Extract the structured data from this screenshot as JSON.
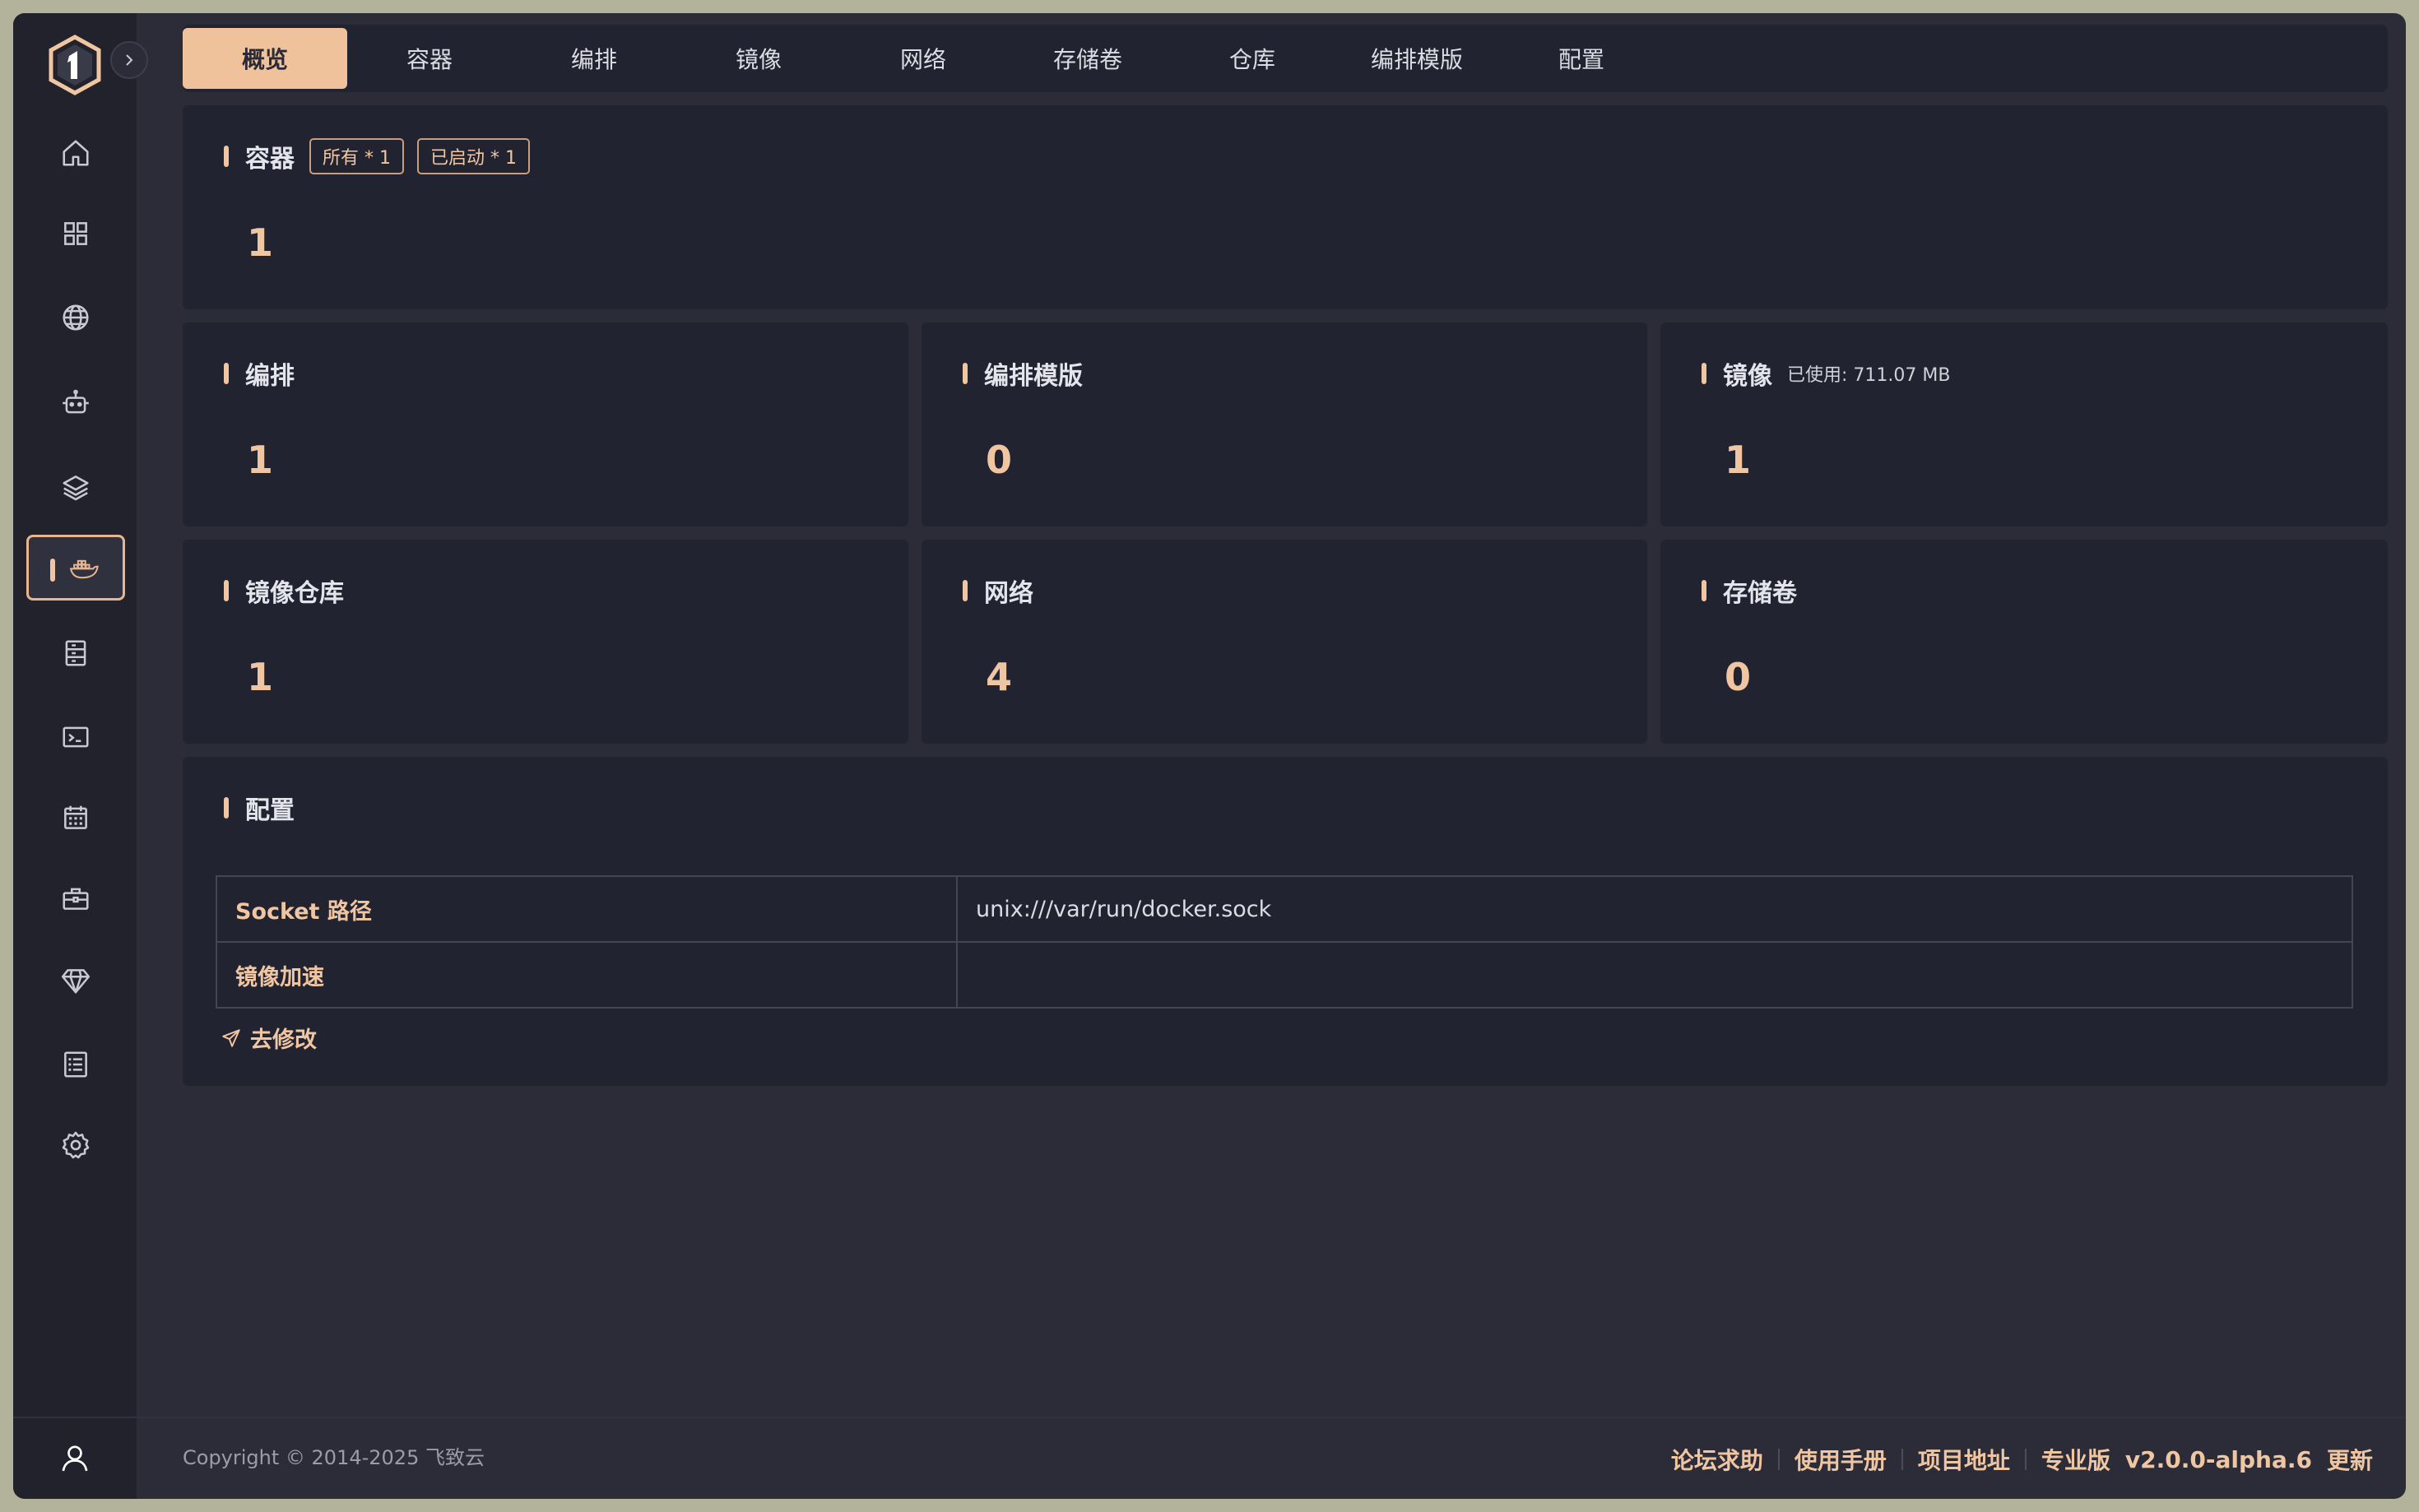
{
  "tabs": [
    {
      "label": "概览",
      "active": true
    },
    {
      "label": "容器"
    },
    {
      "label": "编排"
    },
    {
      "label": "镜像"
    },
    {
      "label": "网络"
    },
    {
      "label": "存储卷"
    },
    {
      "label": "仓库"
    },
    {
      "label": "编排模版"
    },
    {
      "label": "配置"
    }
  ],
  "containers": {
    "title": "容器",
    "badge_all": "所有 * 1",
    "badge_running": "已启动 * 1",
    "value": "1"
  },
  "compose": {
    "title": "编排",
    "value": "1"
  },
  "compose_template": {
    "title": "编排模版",
    "value": "0"
  },
  "images": {
    "title": "镜像",
    "note": "已使用: 711.07 MB",
    "value": "1"
  },
  "registry": {
    "title": "镜像仓库",
    "value": "1"
  },
  "network": {
    "title": "网络",
    "value": "4"
  },
  "volume": {
    "title": "存储卷",
    "value": "0"
  },
  "config": {
    "title": "配置",
    "rows": [
      {
        "key": "Socket 路径",
        "value": "unix:///var/run/docker.sock"
      },
      {
        "key": "镜像加速",
        "value": ""
      }
    ],
    "edit_label": "去修改"
  },
  "footer": {
    "copyright": "Copyright © 2014-2025 飞致云",
    "forum": "论坛求助",
    "manual": "使用手册",
    "project": "项目地址",
    "edition": "专业版",
    "version": "v2.0.0-alpha.6",
    "update": "更新"
  },
  "colors": {
    "accent": "#f0c6a2",
    "sidebar": "#21222c",
    "card": "#222330",
    "bg": "#2b2c38"
  }
}
